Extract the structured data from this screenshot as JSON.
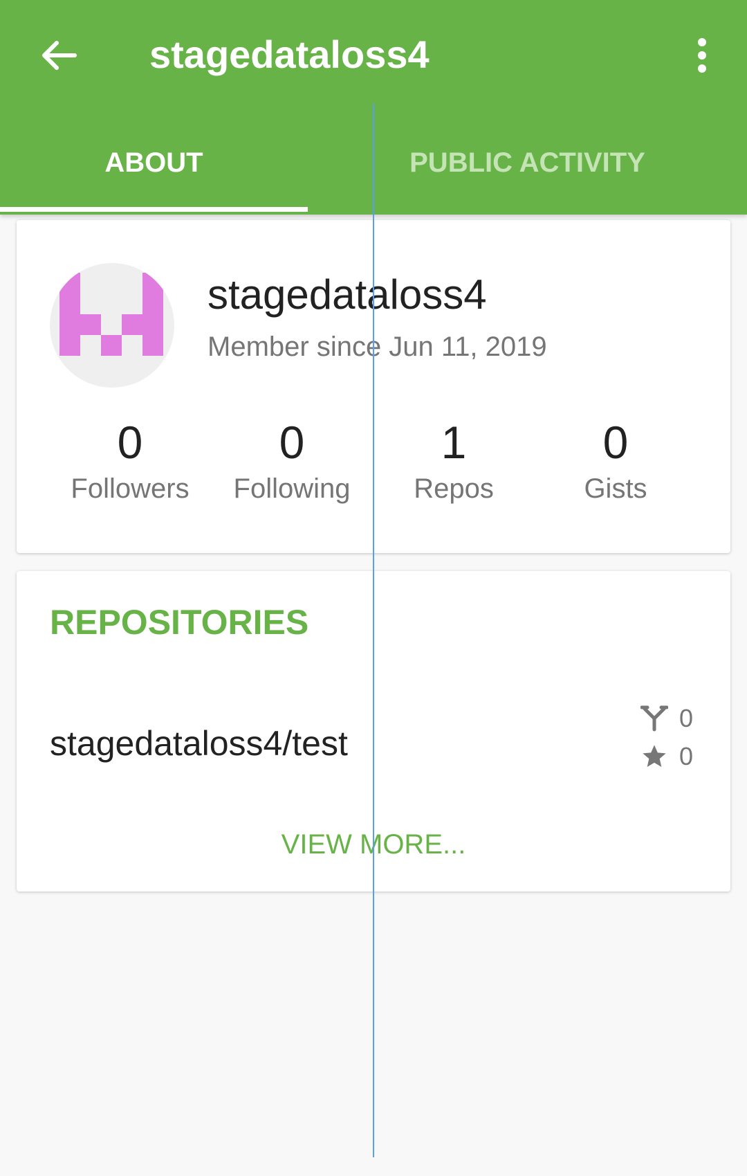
{
  "header": {
    "title": "stagedataloss4",
    "back_icon": "arrow-left-icon",
    "menu_icon": "more-vertical-icon",
    "background_color": "#67b347"
  },
  "tabs": [
    {
      "label": "ABOUT",
      "selected": true
    },
    {
      "label": "PUBLIC ACTIVITY",
      "selected": false
    }
  ],
  "profile": {
    "username": "stagedataloss4",
    "member_since": "Member since Jun 11, 2019",
    "stats": [
      {
        "value": "0",
        "label": "Followers"
      },
      {
        "value": "0",
        "label": "Following"
      },
      {
        "value": "1",
        "label": "Repos"
      },
      {
        "value": "0",
        "label": "Gists"
      }
    ],
    "avatar_color": "#e07be0"
  },
  "repositories": {
    "heading": "REPOSITORIES",
    "items": [
      {
        "name": "stagedataloss4/test",
        "forks": "0",
        "stars": "0"
      }
    ],
    "view_more": "VIEW MORE..."
  },
  "colors": {
    "accent": "#67b347",
    "tab_inactive": "#c4e4b5"
  }
}
